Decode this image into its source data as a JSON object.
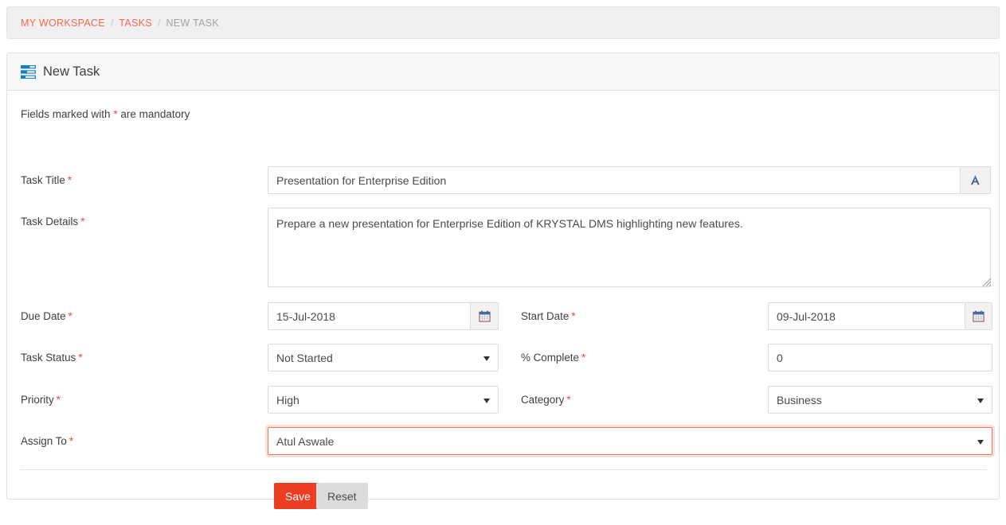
{
  "breadcrumb": {
    "items": [
      {
        "label": "MY WORKSPACE",
        "active": true
      },
      {
        "label": "TASKS",
        "active": true
      },
      {
        "label": "NEW TASK",
        "active": false
      }
    ],
    "separator": "/"
  },
  "panel": {
    "title": "New Task",
    "icon": "list-icon",
    "mandatory_note_prefix": "Fields marked with",
    "mandatory_note_suffix": "are mandatory",
    "required_marker": "*"
  },
  "form": {
    "task_title": {
      "label": "Task Title",
      "required": "*",
      "value": "Presentation for Enterprise Edition",
      "addon_icon": "font-style-a-icon"
    },
    "task_details": {
      "label": "Task Details",
      "required": "*",
      "value": "Prepare a new presentation for Enterprise Edition of KRYSTAL DMS highlighting new features."
    },
    "due_date": {
      "label": "Due Date",
      "required": "*",
      "value": "15-Jul-2018",
      "addon_icon": "calendar-icon"
    },
    "start_date": {
      "label": "Start Date",
      "required": "*",
      "value": "09-Jul-2018",
      "addon_icon": "calendar-icon"
    },
    "task_status": {
      "label": "Task Status",
      "required": "*",
      "value": "Not Started"
    },
    "percent_complete": {
      "label": "% Complete",
      "required": "*",
      "value": "0"
    },
    "priority": {
      "label": "Priority",
      "required": "*",
      "value": "High"
    },
    "category": {
      "label": "Category",
      "required": "*",
      "value": "Business"
    },
    "assign_to": {
      "label": "Assign To",
      "required": "*",
      "value": "Atul Aswale"
    }
  },
  "actions": {
    "save_label": "Save",
    "reset_label": "Reset"
  },
  "colors": {
    "accent_red": "#ec3d22",
    "breadcrumb_link": "#ef6a52",
    "required_star": "#ef4836",
    "icon_blue": "#1480bb",
    "focus_border": "#e8795f"
  }
}
